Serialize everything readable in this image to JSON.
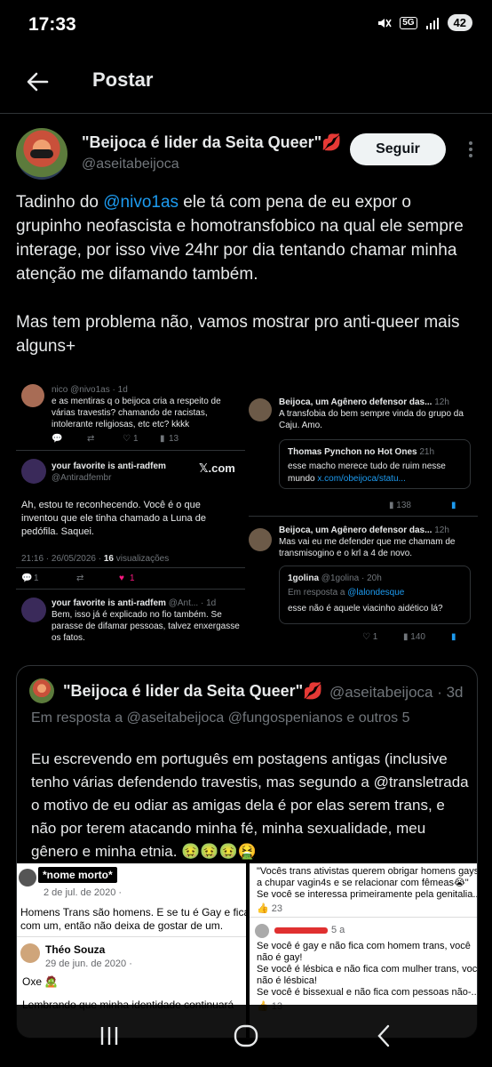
{
  "status_bar": {
    "time": "17:33",
    "network": "5G",
    "battery": "42"
  },
  "header": {
    "title": "Postar"
  },
  "post": {
    "author_name": "\"Beijoca é lider da Seita Queer\"💋",
    "author_handle": "@aseitabeijoca",
    "follow_label": "Seguir",
    "text_before": "Tadinho do ",
    "mention": "@nivo1as",
    "text_after": " ele tá com pena de eu expor o grupinho neofascista e homotransfobico na qual ele sempre interage, por isso vive 24hr por dia tentando chamar minha atenção me difamando também.",
    "text_para2": "Mas tem problema não, vamos mostrar pro anti-queer mais alguns+"
  },
  "image": {
    "left": {
      "top_handle": "nico @nivo1as · 1d",
      "top_text_1": "e as mentiras q o beijoca cria a respeito de",
      "top_text_2": "várias travestis? chamando de racistas,",
      "top_text_3": "intolerante religiosas, etc etc? kkkk",
      "top_stats": [
        "1",
        "1",
        "13"
      ],
      "card_name": "your favorite is anti-radfem",
      "card_handle": "@Antiradfembr",
      "card_brand": "𝕏.com",
      "card_text_1": "Ah, estou te reconhecendo. Você é o que",
      "card_text_2": "inventou que ele tinha chamado a Luna de",
      "card_text_3": "pedófila. Saquei.",
      "card_meta": "21:16 · 26/05/2026 · ",
      "card_views": "16",
      "card_views_label": " visualizações",
      "card_stats": [
        "1",
        "1"
      ],
      "reply_name": "your favorite is anti-radfem",
      "reply_handle": "@Ant... · 1d",
      "reply_text_1": "Bem, isso já é explicado no fio também. Se",
      "reply_text_2": "parasse de difamar pessoas, talvez enxergasse",
      "reply_text_3": "os fatos."
    },
    "right": {
      "t1_name": "Beijoca, um Agênero defensor das...",
      "t1_time": "12h",
      "t1_text_1": "A transfobia do bem sempre vinda do grupo da",
      "t1_text_2": "Caju. Amo.",
      "t1_quote_name": "Thomas Pynchon no Hot Ones",
      "t1_quote_time": "21h",
      "t1_quote_text_1": "esse macho merece tudo de ruim nesse",
      "t1_quote_text_2": "mundo ",
      "t1_quote_link": "x.com/obeijoca/statu...",
      "t1_views": "138",
      "t2_name": "Beijoca, um Agênero defensor das...",
      "t2_time": "12h",
      "t2_text_1": "Mas vai eu me defender que me chamam de",
      "t2_text_2": "transmisogino e o krl a 4 de novo.",
      "t2_quote_name": "1golina",
      "t2_quote_handle": "@1golina · 20h",
      "t2_quote_reply": "Em resposta a ",
      "t2_quote_reply_to": "@lalondesque",
      "t2_quote_text": "esse não é aquele viacinho aidético lá?",
      "t2_likes": "1",
      "t2_views": "140"
    }
  },
  "quote": {
    "author_name": "\"Beijoca é lider da Seita Queer\"💋",
    "meta": "@aseitabeijoca · 3d",
    "reply_line": "Em resposta a @aseitabeijoca @fungospenianos e outros 5",
    "text": "Eu escrevendo em português em postagens antigas (inclusive tenho várias defendendo travestis, mas segundo a @transletrada o motivo de eu odiar as amigas dela é por elas serem trans, e não por terem atacando minha fé, minha sexualidade, meu gênero e minha etnia. 🤢🤢🤢🤮",
    "left_img": {
      "tag": "*nome morto*",
      "date": "2 de jul. de 2020 · ",
      "text_1": "Homens Trans são homens. E se tu é Gay e fica",
      "text_2": "com um, então não deixa de gostar de um.",
      "reply_name": "Théo Souza",
      "reply_date": "29 de jun. de 2020 · ",
      "reply_text": "Oxe 🧟",
      "reply_text_2": "Lembrando que minha identidade continuará"
    },
    "right_img": {
      "text_1": "\"Vocês trans ativistas querem obrigar homens gays",
      "text_2": "a chupar vagin4s e se relacionar com fêmeas😭\"",
      "text_3": "Se você se interessa primeiramente pela genitalia...",
      "count_1": "23",
      "reply_time": "5 a",
      "r_text_1": "Se você é gay e não fica com homem trans, você",
      "r_text_2": "não é gay!",
      "r_text_3": "Se você é lésbica e não fica com mulher trans, você",
      "r_text_4": "não é lésbica!",
      "r_text_5": "Se você é bissexual e não fica com pessoas não-...",
      "count_2": "13"
    }
  },
  "colors": {
    "background": "#000000",
    "text": "#e7e9ea",
    "secondary": "#71767b",
    "accent": "#1d9bf0",
    "border": "#2f3336"
  }
}
